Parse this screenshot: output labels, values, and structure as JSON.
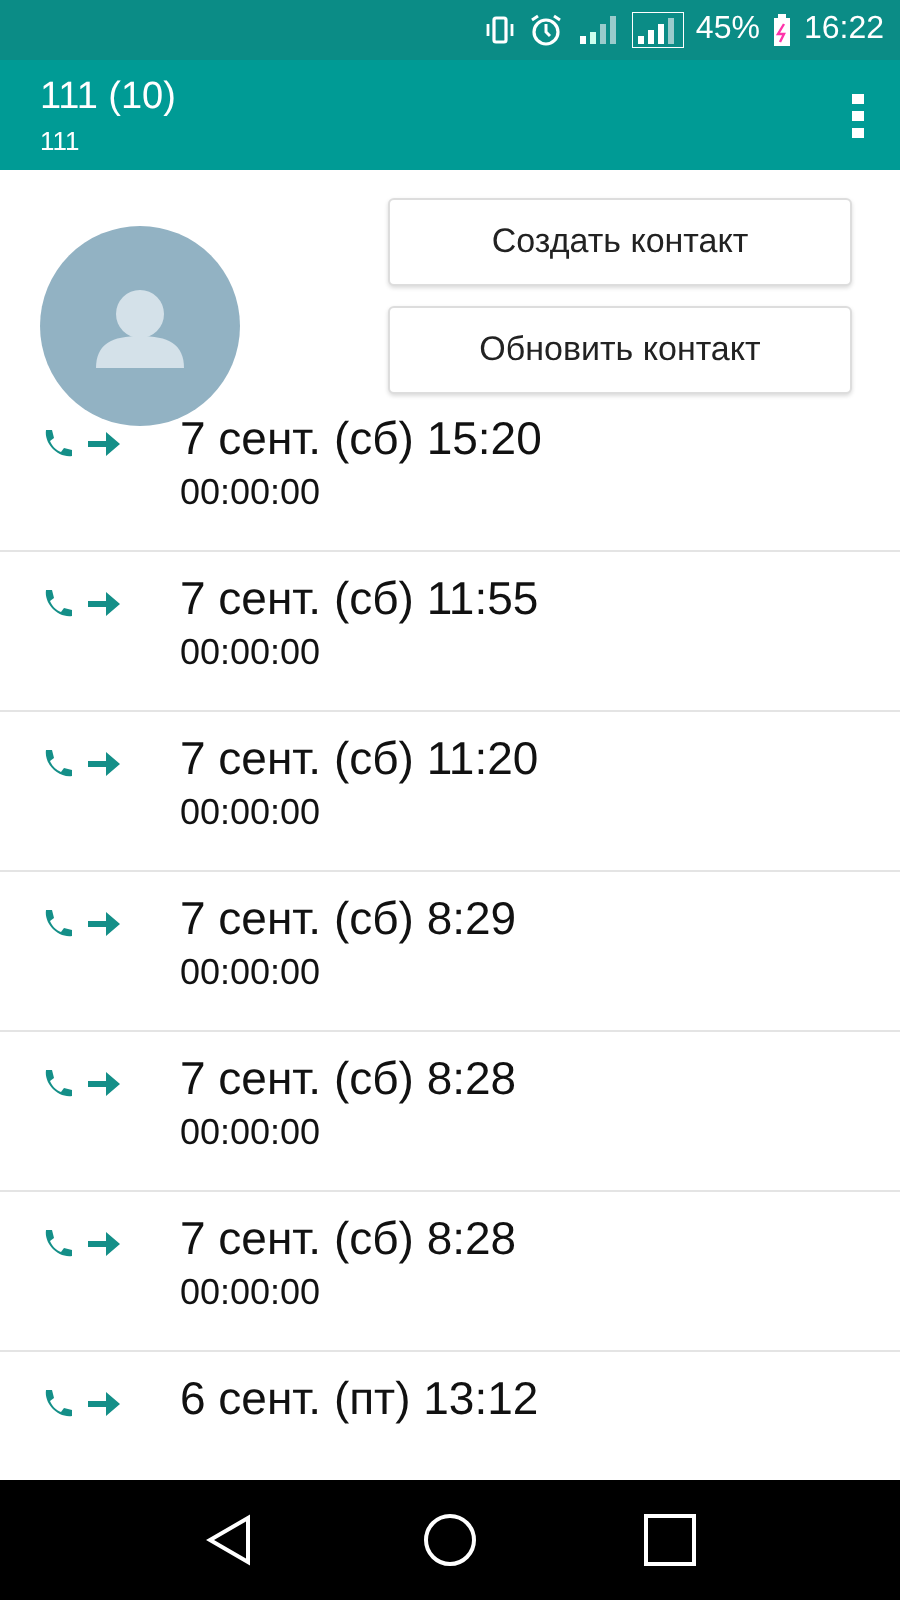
{
  "status_bar": {
    "battery": "45%",
    "time": "16:22"
  },
  "app_bar": {
    "title": "111 (10)",
    "subtitle": "111"
  },
  "buttons": [
    "Создать контакт",
    "Обновить контакт"
  ],
  "calls": [
    {
      "date": "7 сент. (сб) 15:20",
      "duration": "00:00:00"
    },
    {
      "date": "7 сент. (сб) 11:55",
      "duration": "00:00:00"
    },
    {
      "date": "7 сент. (сб) 11:20",
      "duration": "00:00:00"
    },
    {
      "date": "7 сент. (сб) 8:29",
      "duration": "00:00:00"
    },
    {
      "date": "7 сент. (сб) 8:28",
      "duration": "00:00:00"
    },
    {
      "date": "7 сент. (сб) 8:28",
      "duration": "00:00:00"
    },
    {
      "date": "6 сент. (пт) 13:12"
    }
  ]
}
